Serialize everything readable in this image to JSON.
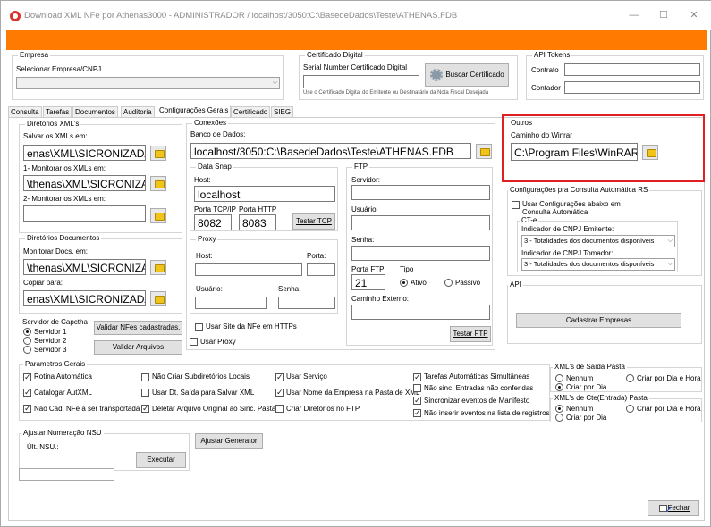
{
  "window": {
    "title": "Download XML NFe por Athenas3000  - ADMINISTRADOR / localhost/3050:C:\\BasedeDados\\Teste\\ATHENAS.FDB",
    "minimize": "—",
    "maximize": "☐",
    "close": "✕"
  },
  "empresa": {
    "group": "Empresa",
    "label": "Selecionar Empresa/CNPJ",
    "value": ""
  },
  "certificado": {
    "group": "Certificado Digital",
    "label": "Serial Number Certificado Digital",
    "value": "",
    "button": "Buscar Certificado",
    "note": "Use o Certificado Digital do Emitente ou Destinatário da Nota Fiscal Desejada"
  },
  "api_tokens": {
    "group": "API Tokens",
    "contrato_label": "Contrato",
    "contrato": "",
    "contador_label": "Contador",
    "contador": ""
  },
  "tabs": [
    "Consulta",
    "Tarefas",
    "Documentos",
    "Auditoria",
    "Configurações Gerais",
    "Certificado",
    "SIEG"
  ],
  "diretorios_xml": {
    "group": "Diretórios XML's",
    "salvar_label": "Salvar os XMLs em:",
    "salvar": "enas\\XML\\SICRONIZADAS",
    "monitorar1_label": "1- Monitorar os XMLs em:",
    "monitorar1": "\\thenas\\XML\\SICRONIZAR",
    "monitorar2_label": "2- Monitorar os XMLs em:",
    "monitorar2": ""
  },
  "diretorios_docs": {
    "group": "Diretórios Documentos",
    "monitorar_label": "Monitorar Docs.  em:",
    "monitorar": "\\thenas\\XML\\SICRONIZAR",
    "copiar_label": "Copiar para:",
    "copiar": "enas\\XML\\SICRONIZADAS"
  },
  "captcha": {
    "group": "Servidor de Capctha",
    "options": [
      "Servidor 1",
      "Servidor 2",
      "Servidor 3"
    ],
    "validar_cadastradas": "Validar NFes cadastradas.",
    "validar_arquivos": "Validar Arquivos"
  },
  "conexoes": {
    "group": "Conexões",
    "banco_label": "Banco de Dados:",
    "banco": "localhost/3050:C:\\BasedeDados\\Teste\\ATHENAS.FDB"
  },
  "datasnap": {
    "group": "Data Snap",
    "host_label": "Host:",
    "host": "localhost",
    "porta_tcp_label": "Porta TCP/IP",
    "porta_tcp": "8082",
    "porta_http_label": "Porta HTTP",
    "porta_http": "8083",
    "testar_tcp": "Testar TCP"
  },
  "proxy": {
    "group": "Proxy",
    "host_label": "Host:",
    "porta_label": "Porta:",
    "usuario_label": "Usuário:",
    "senha_label": "Senha:",
    "usar_site": "Usar Site da NFe em HTTPs",
    "usar_proxy": "Usar Proxy"
  },
  "ftp": {
    "group": "FTP",
    "servidor_label": "Servidor:",
    "usuario_label": "Usuário:",
    "senha_label": "Senha:",
    "porta_label": "Porta FTP",
    "porta": "21",
    "tipo_label": "Tipo",
    "ativo": "Ativo",
    "passivo": "Passivo",
    "caminho_label": "Caminho Externo:",
    "testar_ftp": "Testar FTP"
  },
  "outros": {
    "group": "Outros",
    "winrar_label": "Caminho do Winrar",
    "winrar": "C:\\Program Files\\WinRAR"
  },
  "consulta_auto": {
    "group": "Configurações pra Consulta Automática RS",
    "usar_cfg": "Usar Configurações abaixo em Consulta Automática",
    "cte_group": "CT-e",
    "emitente_label": "Indicador de CNPJ Emitente:",
    "emitente": "3 - Totalidades dos documentos disponíveis",
    "tomador_label": "Indicador de CNPJ Tomador:",
    "tomador": "3 - Totalidades dos documentos disponíveis"
  },
  "api": {
    "group": "API",
    "cadastrar": "Cadastrar Empresas"
  },
  "parametros": {
    "group": "Parametros Gerais",
    "items": [
      {
        "label": "Rotina Automática",
        "checked": true
      },
      {
        "label": "Não Criar Subdiretórios Locais",
        "checked": false
      },
      {
        "label": "Usar Serviço",
        "checked": true
      },
      {
        "label": "Tarefas Automáticas Simultâneas",
        "checked": true
      },
      {
        "label": "Catalogar AutXML",
        "checked": true
      },
      {
        "label": "Usar Dt. Saída para Salvar XML",
        "checked": false
      },
      {
        "label": "Usar Nome da Empresa na Pasta de XML",
        "checked": true
      },
      {
        "label": "Não sinc. Entradas não conferidas",
        "checked": false
      },
      {
        "label": "Sincronizar eventos de Manifesto",
        "checked": true
      },
      {
        "label": "Não Cad. NFe a ser transportada",
        "checked": true
      },
      {
        "label": "Deletar Arquivo Original ao Sinc. Pasta",
        "checked": true
      },
      {
        "label": "Criar Diretórios no FTP",
        "checked": false
      },
      {
        "label": "Não inserir eventos na lista de registros",
        "checked": true
      }
    ]
  },
  "xml_saida": {
    "group": "XML's de Saída Pasta",
    "nenhum": "Nenhum",
    "criar_dia_hora": "Criar por Dia e Hora",
    "criar_dia": "Criar por Dia"
  },
  "xml_cte": {
    "group": "XML's de Cte(Entrada) Pasta",
    "nenhum": "Nenhum",
    "criar_dia_hora": "Criar por Dia e Hora",
    "criar_dia": "Criar por Dia"
  },
  "nsu": {
    "group": "Ajustar Numeração NSU",
    "ult_label": "Últ. NSU.:",
    "executar": "Executar",
    "ajustar_generator": "Ajustar Generator"
  },
  "fechar": "Fechar",
  "colors": {
    "accent": "#ff7a00",
    "highlight": "#e02020"
  }
}
